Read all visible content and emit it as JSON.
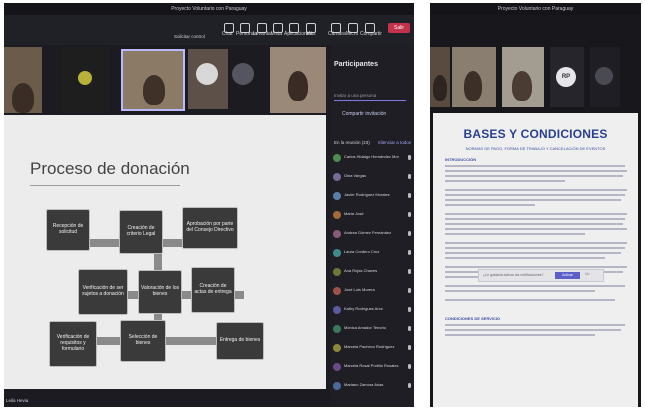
{
  "left": {
    "window_title": "Proyecto Voluntario con Paraguay",
    "meeting_label": "Solicitar control",
    "toolbar": [
      "Chat",
      "Personas",
      "Levantar",
      "Vista",
      "Aplicaciones",
      "Más",
      "Cámara",
      "Micro",
      "Compartir"
    ],
    "leave_label": "Salir",
    "slide": {
      "title": "Proceso de donación",
      "boxes": [
        "Recepción de solicitud",
        "Creación de criterio Legal",
        "Aprobación por parte del Consejo Directivo",
        "Verificación de ser sujetos a donación",
        "Valoración de los bienes",
        "Creación de actas de entrega",
        "Verificación de requisitos y formulario",
        "Selección de bienes",
        "Entrega de bienes"
      ]
    },
    "presenter": "Leila Hevia",
    "participants": {
      "title": "Participantes",
      "search_placeholder": "Invitar a una persona",
      "share_invite": "Compartir invitación",
      "section_label": "En la reunión (23)",
      "mute_all": "Silenciar a todos",
      "names": [
        "Carlos Hidalgo Hernández Morales",
        "Gina Vargas",
        "Javier Rodríguez Morales",
        "Maria José",
        "Andrea Gómez Fernández",
        "Laura Cordero Cruz",
        "Ana Rojas Chaves",
        "José Luis Morera",
        "Kathy Rodríguez Arce",
        "Mónica Amador Tenorio",
        "Marcela Pacheco Rodríguez",
        "Marcela Rosal Portillo Rosales",
        "Mariano Zamora Arias"
      ],
      "avatar_colors": [
        "#4f8a4f",
        "#7a6a9a",
        "#5a7fa8",
        "#a06a3a",
        "#8a5a7a",
        "#3f8a8a",
        "#6a7a3a",
        "#a0504a",
        "#5a5aa0",
        "#3a7a5a",
        "#8a8a3a",
        "#6a4a8a",
        "#4a6a9a"
      ]
    }
  },
  "right": {
    "window_title": "Proyecto Voluntario con Paraguay",
    "avatar_initials": "RP",
    "doc": {
      "title": "BASES Y CONDICIONES",
      "subtitle": "NORMAS DE PAGO, FORMA DE TRABAJO Y CANCELACIÓN DE EVENTOS",
      "heading1": "INTRODUCCIÓN",
      "heading2": "CONDICIONES DE SERVICIO"
    },
    "banner": {
      "text": "¿Le gustaría activar las notificaciones?",
      "button": "Activar",
      "dismiss": "No"
    }
  }
}
